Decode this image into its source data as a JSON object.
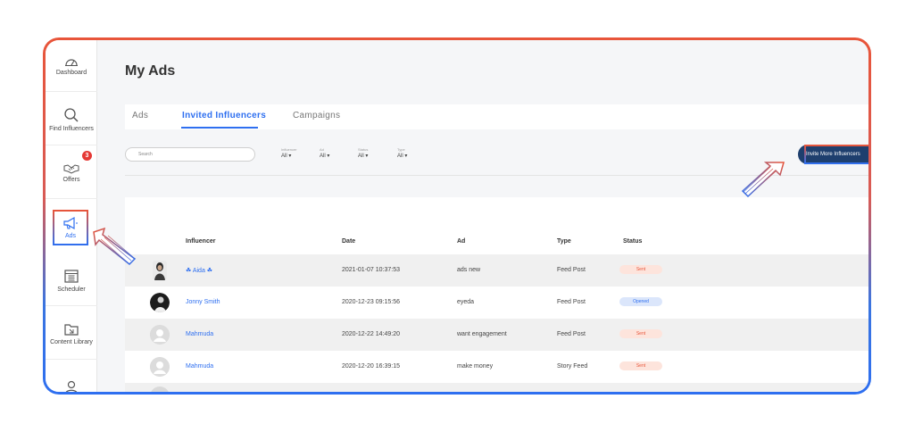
{
  "sidebar": {
    "items": [
      {
        "label": "Dashboard",
        "icon": "gauge-icon"
      },
      {
        "label": "Find Influencers",
        "icon": "search-icon"
      },
      {
        "label": "Offers",
        "icon": "handshake-icon",
        "badge": "3"
      },
      {
        "label": "Ads",
        "icon": "megaphone-icon"
      },
      {
        "label": "Scheduler",
        "icon": "calendar-icon"
      },
      {
        "label": "Content Library",
        "icon": "folder-icon"
      },
      {
        "label": "",
        "icon": "profile-icon"
      }
    ]
  },
  "page": {
    "title": "My Ads"
  },
  "tabs": [
    {
      "label": "Ads"
    },
    {
      "label": "Invited Influencers"
    },
    {
      "label": "Campaigns"
    }
  ],
  "filters": {
    "search_placeholder": "Search",
    "items": [
      {
        "label": "Influencer",
        "value": "All"
      },
      {
        "label": "Ad",
        "value": "All"
      },
      {
        "label": "Status",
        "value": "All"
      },
      {
        "label": "Type",
        "value": "All"
      }
    ]
  },
  "invite_button": {
    "label": "Invite More Influencers"
  },
  "table": {
    "headers": [
      "Influencer",
      "Date",
      "Ad",
      "Type",
      "Status"
    ],
    "rows": [
      {
        "influencer": "☘ Aida ☘",
        "date": "2021-01-07 10:37:53",
        "ad": "ads new",
        "type": "Feed Post",
        "status": "Sent"
      },
      {
        "influencer": "Jonny Smith",
        "date": "2020-12-23 09:15:56",
        "ad": "eyeda",
        "type": "Feed Post",
        "status": "Opened"
      },
      {
        "influencer": "Mahmuda",
        "date": "2020-12-22 14:49:20",
        "ad": "want engagement",
        "type": "Feed Post",
        "status": "Sent"
      },
      {
        "influencer": "Mahmuda",
        "date": "2020-12-20 16:39:15",
        "ad": "make money",
        "type": "Story Feed",
        "status": "Sent"
      }
    ]
  },
  "colors": {
    "accent": "#2e6ff0",
    "highlight_top": "#e8553a",
    "highlight_bottom": "#2e6ff0",
    "status_sent": "#e8553a",
    "status_opened": "#2e6ff0"
  }
}
